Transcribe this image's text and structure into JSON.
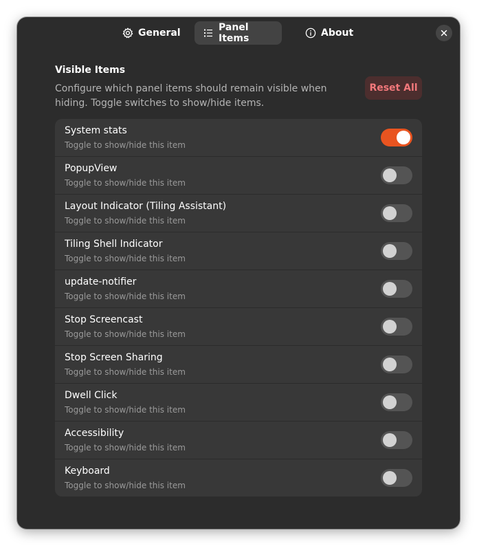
{
  "tabs": [
    {
      "label": "General",
      "icon": "gear-icon",
      "active": false
    },
    {
      "label": "Panel Items",
      "icon": "list-icon",
      "active": true
    },
    {
      "label": "About",
      "icon": "info-icon",
      "active": false
    }
  ],
  "group": {
    "title": "Visible Items",
    "description": "Configure which panel items should remain visible when hiding. Toggle switches to show/hide items.",
    "reset_label": "Reset All"
  },
  "items": [
    {
      "title": "System stats",
      "subtitle": "Toggle to show/hide this item",
      "enabled": true
    },
    {
      "title": "PopupView",
      "subtitle": "Toggle to show/hide this item",
      "enabled": false
    },
    {
      "title": "Layout Indicator (Tiling Assistant)",
      "subtitle": "Toggle to show/hide this item",
      "enabled": false
    },
    {
      "title": "Tiling Shell Indicator",
      "subtitle": "Toggle to show/hide this item",
      "enabled": false
    },
    {
      "title": "update-notifier",
      "subtitle": "Toggle to show/hide this item",
      "enabled": false
    },
    {
      "title": "Stop Screencast",
      "subtitle": "Toggle to show/hide this item",
      "enabled": false
    },
    {
      "title": "Stop Screen Sharing",
      "subtitle": "Toggle to show/hide this item",
      "enabled": false
    },
    {
      "title": "Dwell Click",
      "subtitle": "Toggle to show/hide this item",
      "enabled": false
    },
    {
      "title": "Accessibility",
      "subtitle": "Toggle to show/hide this item",
      "enabled": false
    },
    {
      "title": "Keyboard",
      "subtitle": "Toggle to show/hide this item",
      "enabled": false
    }
  ],
  "colors": {
    "accent": "#e95420",
    "destructive_text": "#f2787b",
    "window_bg": "#2c2c2c",
    "list_bg": "#383838"
  }
}
